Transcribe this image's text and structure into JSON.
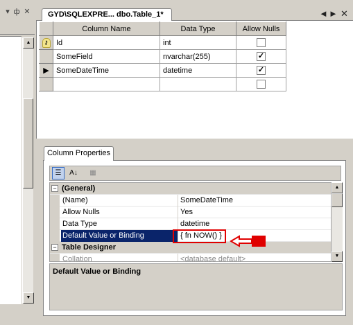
{
  "left_panel": {
    "controls": [
      "▾",
      "ф",
      "✕"
    ],
    "scroll_up": "▲",
    "scroll_down": "▼"
  },
  "document_tab": {
    "title": "GYD\\SQLEXPRE... dbo.Table_1*",
    "controls": [
      "◄",
      "►",
      "✕"
    ]
  },
  "table_designer": {
    "headers": [
      "Column Name",
      "Data Type",
      "Allow Nulls"
    ],
    "rows": [
      {
        "name": "Id",
        "type": "int",
        "allow_nulls": false,
        "primary_key": true,
        "selected": false
      },
      {
        "name": "SomeField",
        "type": "nvarchar(255)",
        "allow_nulls": true,
        "primary_key": false,
        "selected": false
      },
      {
        "name": "SomeDateTime",
        "type": "datetime",
        "allow_nulls": true,
        "primary_key": false,
        "selected": true
      },
      {
        "name": "",
        "type": "",
        "allow_nulls": false,
        "primary_key": false,
        "selected": false
      }
    ]
  },
  "column_properties": {
    "tab_label": "Column Properties",
    "toolbar": {
      "categorized_icon": "categorized-icon",
      "alphabetical_icon": "alphabetical-icon",
      "property_pages_icon": "property-pages-icon"
    },
    "categories": [
      {
        "label": "(General)",
        "expander": "⊟",
        "properties": [
          {
            "name": "(Name)",
            "value": "SomeDateTime"
          },
          {
            "name": "Allow Nulls",
            "value": "Yes"
          },
          {
            "name": "Data Type",
            "value": "datetime"
          },
          {
            "name": "Default Value or Binding",
            "value": "{ fn NOW() }",
            "selected": true
          }
        ]
      },
      {
        "label": "Table Designer",
        "expander": "⊟",
        "properties": [
          {
            "name": "Collation",
            "value": "<database default>",
            "dimmed": true
          }
        ]
      }
    ],
    "description_title": "Default Value or Binding"
  },
  "colors": {
    "chrome": "#d4d0c8",
    "selection": "#0a246a",
    "highlight_box": "#e00000"
  }
}
